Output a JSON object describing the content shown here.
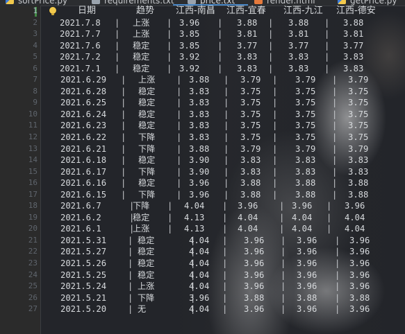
{
  "tabs": [
    {
      "label": "sortPrice.py",
      "type": "py",
      "active": false
    },
    {
      "label": "requirements.txt",
      "type": "txt",
      "active": false
    },
    {
      "label": "price.txt",
      "type": "txt",
      "active": true
    },
    {
      "label": "render.html",
      "type": "html",
      "active": false
    },
    {
      "label": "getPrice.py",
      "type": "py",
      "active": false
    }
  ],
  "editor": {
    "header": [
      "日期",
      "趋势",
      "江西-南昌",
      "江西-宜春",
      "江西-九江",
      "江西-德安"
    ],
    "rows": [
      [
        "2021.7.8",
        "上涨",
        "3.96",
        "3.88",
        "3.88",
        "3.88"
      ],
      [
        "2021.7.7",
        "上涨",
        "3.85",
        "3.81",
        "3.81",
        "3.81"
      ],
      [
        "2021.7.6",
        "稳定",
        "3.85",
        "3.77",
        "3.77",
        "3.77"
      ],
      [
        "2021.7.2",
        "稳定",
        "3.92",
        "3.83",
        "3.83",
        "3.83"
      ],
      [
        "2021.7.1",
        "稳定",
        "3.92",
        "3.83",
        "3.83",
        "3.83"
      ],
      [
        "2021.6.29",
        "上涨",
        "3.88",
        "3.79",
        "3.79",
        "3.79"
      ],
      [
        "2021.6.28",
        "稳定",
        "3.83",
        "3.75",
        "3.75",
        "3.75"
      ],
      [
        "2021.6.25",
        "稳定",
        "3.83",
        "3.75",
        "3.75",
        "3.75"
      ],
      [
        "2021.6.24",
        "稳定",
        "3.83",
        "3.75",
        "3.75",
        "3.75"
      ],
      [
        "2021.6.23",
        "稳定",
        "3.83",
        "3.75",
        "3.75",
        "3.75"
      ],
      [
        "2021.6.22",
        "下降",
        "3.83",
        "3.75",
        "3.75",
        "3.75"
      ],
      [
        "2021.6.21",
        "下降",
        "3.88",
        "3.79",
        "3.79",
        "3.79"
      ],
      [
        "2021.6.18",
        "稳定",
        "3.90",
        "3.83",
        "3.83",
        "3.83"
      ],
      [
        "2021.6.17",
        "下降",
        "3.90",
        "3.83",
        "3.83",
        "3.83"
      ],
      [
        "2021.6.16",
        "稳定",
        "3.96",
        "3.88",
        "3.88",
        "3.88"
      ],
      [
        "2021.6.15",
        "下降",
        "3.96",
        "3.88",
        "3.88",
        "3.88"
      ],
      [
        "2021.6.7",
        "下降",
        "4.04",
        "3.96",
        "3.96",
        "3.96"
      ],
      [
        "2021.6.2",
        "稳定",
        "4.13",
        "4.04",
        "4.04",
        "4.04"
      ],
      [
        "2021.6.1",
        "上涨",
        "4.13",
        "4.04",
        "4.04",
        "4.04"
      ],
      [
        "2021.5.31",
        "稳定",
        "4.04",
        "3.96",
        "3.96",
        "3.96"
      ],
      [
        "2021.5.27",
        "稳定",
        "4.04",
        "3.96",
        "3.96",
        "3.96"
      ],
      [
        "2021.5.26",
        "稳定",
        "4.04",
        "3.96",
        "3.96",
        "3.96"
      ],
      [
        "2021.5.25",
        "稳定",
        "4.04",
        "3.96",
        "3.96",
        "3.96"
      ],
      [
        "2021.5.24",
        "上涨",
        "4.04",
        "3.96",
        "3.96",
        "3.96"
      ],
      [
        "2021.5.21",
        "下降",
        "3.96",
        "3.88",
        "3.88",
        "3.88"
      ],
      [
        "2021.5.20",
        "无",
        "4.04",
        "3.96",
        "3.96",
        "3.96"
      ]
    ]
  },
  "colors": {
    "line_number": "#5f656d",
    "text": "#d7dadd",
    "active_tab_underline": "#4a88c7"
  }
}
